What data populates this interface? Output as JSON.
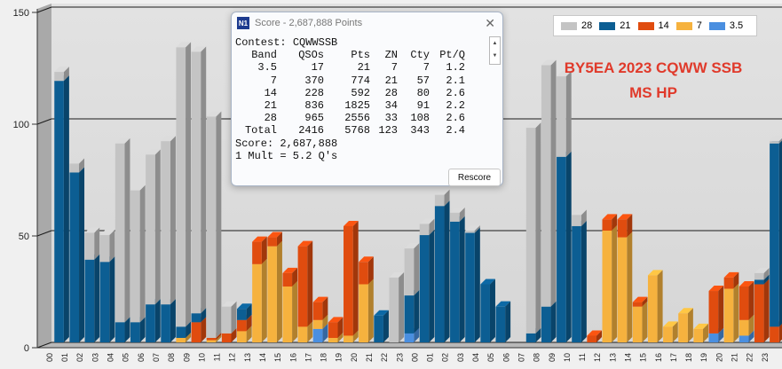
{
  "window": {
    "title": "Score - 2,687,888 Points"
  },
  "scoreBox": {
    "contest_label": "Contest:",
    "contest_value": "CQWWSSB",
    "columns": [
      "Band",
      "QSOs",
      "Pts",
      "ZN",
      "Cty",
      "Pt/Q"
    ],
    "rows": [
      [
        "3.5",
        "17",
        "21",
        "7",
        "7",
        "1.2"
      ],
      [
        "7",
        "370",
        "774",
        "21",
        "57",
        "2.1"
      ],
      [
        "14",
        "228",
        "592",
        "28",
        "80",
        "2.6"
      ],
      [
        "21",
        "836",
        "1825",
        "34",
        "91",
        "2.2"
      ],
      [
        "28",
        "965",
        "2556",
        "33",
        "108",
        "2.6"
      ],
      [
        "Total",
        "2416",
        "5768",
        "123",
        "343",
        "2.4"
      ]
    ],
    "score_line": "Score: 2,687,888",
    "mult_line": "1 Mult = 5.2 Q's",
    "rescore_label": "Rescore"
  },
  "chart_data": {
    "type": "bar",
    "stacked": true,
    "title_lines": [
      "BY5EA 2023 CQWW SSB",
      "MS HP"
    ],
    "ylim": [
      0,
      150
    ],
    "yticks": [
      0,
      50,
      100,
      150
    ],
    "categories": [
      "00",
      "01",
      "02",
      "03",
      "04",
      "05",
      "06",
      "07",
      "08",
      "09",
      "10",
      "11",
      "12",
      "13",
      "14",
      "15",
      "16",
      "17",
      "18",
      "19",
      "20",
      "21",
      "22",
      "23",
      "00",
      "01",
      "02",
      "03",
      "04",
      "05",
      "06",
      "07",
      "08",
      "09",
      "10",
      "11",
      "12",
      "13",
      "14",
      "15",
      "16",
      "17",
      "18",
      "19",
      "20",
      "21",
      "22",
      "23"
    ],
    "series": [
      {
        "name": "3.5",
        "color": "#4a8fe0",
        "values": [
          0,
          0,
          0,
          0,
          0,
          0,
          0,
          0,
          0,
          0,
          0,
          0,
          0,
          0,
          0,
          0,
          0,
          6,
          0,
          0,
          0,
          0,
          0,
          4,
          0,
          0,
          0,
          0,
          0,
          0,
          0,
          0,
          0,
          0,
          0,
          0,
          0,
          0,
          0,
          0,
          0,
          0,
          0,
          4,
          0,
          3,
          0,
          0
        ]
      },
      {
        "name": "7",
        "color": "#f6b23e",
        "values": [
          0,
          0,
          0,
          0,
          0,
          0,
          0,
          0,
          2,
          0,
          1,
          0,
          5,
          35,
          43,
          25,
          7,
          4,
          2,
          3,
          26,
          0,
          0,
          0,
          0,
          0,
          0,
          0,
          0,
          0,
          0,
          0,
          0,
          0,
          0,
          0,
          50,
          47,
          16,
          30,
          7,
          13,
          6,
          0,
          24,
          7,
          0,
          0
        ]
      },
      {
        "name": "14",
        "color": "#e04c0f",
        "values": [
          0,
          0,
          0,
          0,
          0,
          0,
          0,
          0,
          0,
          9,
          1,
          4,
          5,
          10,
          4,
          6,
          36,
          8,
          7,
          49,
          10,
          0,
          0,
          0,
          0,
          0,
          0,
          0,
          0,
          0,
          0,
          0,
          0,
          0,
          0,
          3,
          5,
          8,
          2,
          0,
          0,
          0,
          0,
          19,
          5,
          15,
          26,
          7
        ]
      },
      {
        "name": "21",
        "color": "#0c5e93",
        "values": [
          117,
          76,
          37,
          36,
          9,
          9,
          17,
          17,
          5,
          4,
          0,
          0,
          5,
          0,
          0,
          0,
          0,
          0,
          0,
          0,
          0,
          12,
          0,
          17,
          48,
          61,
          54,
          49,
          26,
          16,
          0,
          4,
          16,
          83,
          52,
          0,
          0,
          0,
          0,
          0,
          0,
          0,
          0,
          0,
          0,
          0,
          2,
          82
        ]
      },
      {
        "name": "28",
        "color": "#c4c4c4",
        "values": [
          4,
          4,
          12,
          12,
          80,
          59,
          67,
          73,
          125,
          117,
          99,
          12,
          0,
          0,
          0,
          0,
          0,
          0,
          0,
          0,
          0,
          0,
          29,
          21,
          5,
          5,
          4,
          1,
          0,
          0,
          0,
          92,
          108,
          36,
          5,
          0,
          0,
          0,
          0,
          0,
          0,
          0,
          0,
          0,
          0,
          0,
          3,
          1
        ]
      }
    ],
    "legend_order": [
      "28",
      "21",
      "14",
      "7",
      "3.5"
    ],
    "legend_position": "top-right"
  }
}
